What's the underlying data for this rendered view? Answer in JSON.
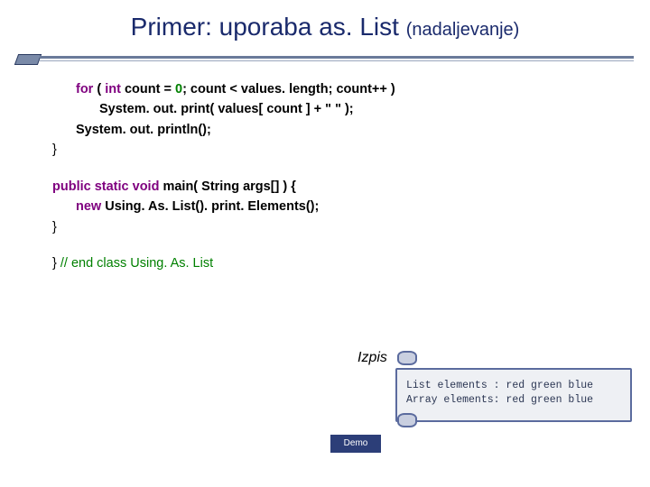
{
  "title": {
    "main": "Primer: uporaba as. List",
    "sub": "(nadaljevanje)"
  },
  "code": {
    "l1_kw": "for",
    "l1_rest_a": " ( ",
    "l1_kw2": "int",
    "l1_rest_b": " count = ",
    "l1_zero": "0",
    "l1_rest_c": "; count < values. length; count++ )",
    "l2": "System. out. print( values[ count ] + \"  \" );",
    "l3": "System. out. println();",
    "l4": "}",
    "l5_kw": "public static void",
    "l5_rest": " main( String args[] ) {",
    "l6_kw": "new",
    "l6_rest": " Using. As. List(). print. Elements();",
    "l7": "}",
    "l8": "} ",
    "l8_cmt": "// end class Using. As. List"
  },
  "output": {
    "label": "Izpis",
    "line1": "List elements : red green blue",
    "line2": "Array elements: red green blue"
  },
  "demo": {
    "label": "Demo"
  }
}
